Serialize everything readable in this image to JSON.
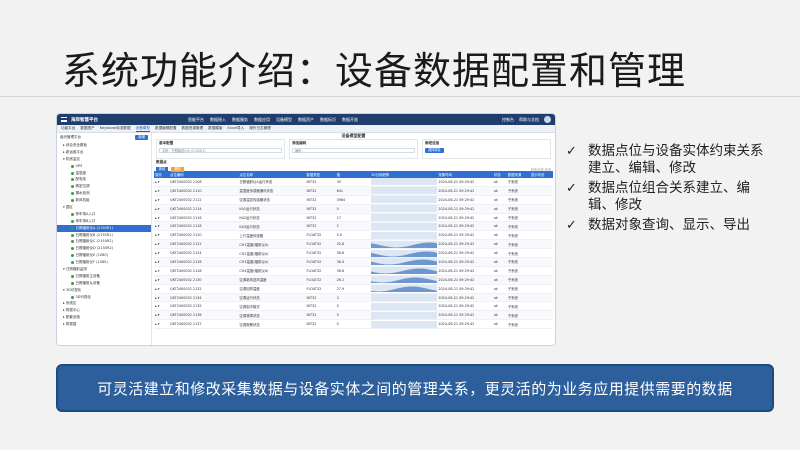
{
  "slide": {
    "title": "系统功能介绍：设备数据配置和管理",
    "bullets": [
      "数据点位与设备实体约束关系建立、编辑、修改",
      "数据点位组合关系建立、编辑、修改",
      "数据对象查询、显示、导出"
    ],
    "banner": "可灵活建立和修改采集数据与设备实体之间的管理关系，更灵活的为业务应用提供需要的数据"
  },
  "app": {
    "brand": "海岸智慧平台",
    "nav": [
      "智能平台",
      "数据接入",
      "数据服务",
      "数据应用",
      "设备模型",
      "数据资产",
      "数据标识",
      "数据开放"
    ],
    "right": [
      "控制台",
      "帮助与文档"
    ],
    "tabs": [
      "功能平台",
      "数据资产",
      "Keystone标准数据",
      "设备模型",
      "数据编辑配置",
      "数据资源管理",
      "数据模版",
      "Excel导入",
      "操作日志管理"
    ],
    "active_tab": "设备模型",
    "sidebar": {
      "header": "组织管理平台",
      "button": "新增",
      "items": [
        {
          "label": "▸ 综合安全看板",
          "sel": false,
          "dot": false
        },
        {
          "label": "▸ 新运维平台",
          "sel": false,
          "dot": false
        },
        {
          "label": "▾ 机房监控",
          "sel": false,
          "dot": false
        },
        {
          "label": "UPS",
          "sel": false,
          "dot": true
        },
        {
          "label": "温湿度",
          "sel": false,
          "dot": true
        },
        {
          "label": "配电柜",
          "sel": false,
          "dot": true
        },
        {
          "label": "精密空调",
          "sel": false,
          "dot": true
        },
        {
          "label": "漏水检测",
          "sel": false,
          "dot": true
        },
        {
          "label": "新风机组",
          "sel": false,
          "dot": true
        },
        {
          "label": "▾ 园区",
          "sel": false,
          "dot": false
        },
        {
          "label": "停车场A入口",
          "sel": false,
          "dot": true
        },
        {
          "label": "停车场B入口",
          "sel": false,
          "dot": true
        },
        {
          "label": "日照辐射仪A (2150R1)",
          "sel": true,
          "dot": true
        },
        {
          "label": "日照辐射仪B (2150R1)",
          "sel": false,
          "dot": true
        },
        {
          "label": "日照辐射仪C (2150R2)",
          "sel": false,
          "dot": true
        },
        {
          "label": "日照辐射仪D (2150R2)",
          "sel": false,
          "dot": true
        },
        {
          "label": "日照辐射仪E (1080)",
          "sel": false,
          "dot": true
        },
        {
          "label": "日照辐射仪F (1080)",
          "sel": false,
          "dot": true
        },
        {
          "label": "▾ 日照辐射监测",
          "sel": false,
          "dot": false
        },
        {
          "label": "日照辐射主设备",
          "sel": false,
          "dot": true
        },
        {
          "label": "日照辐射从设备",
          "sel": false,
          "dot": true
        },
        {
          "label": "▾ 3D可视化",
          "sel": false,
          "dot": false
        },
        {
          "label": "3D可视化",
          "sel": false,
          "dot": true
        },
        {
          "label": "▸ 系统区",
          "sel": false,
          "dot": false
        },
        {
          "label": "▸ 附属中心",
          "sel": false,
          "dot": false
        },
        {
          "label": "▸ 配套设施",
          "sel": false,
          "dot": false
        },
        {
          "label": "▸ 附属楼",
          "sel": false,
          "dot": false
        }
      ]
    },
    "main": {
      "section_title": "设备模型配置",
      "panel1": {
        "title": "基本配置",
        "field": "名称：日照辐射仪A (2150R1)"
      },
      "panel2": {
        "title": "添加编码",
        "field": "编码："
      },
      "panel3": {
        "title": "绑定设备",
        "button": "选择绑定"
      },
      "data_title": "数据点",
      "toolbar": {
        "add": "新增",
        "delete": "删除",
        "search": "检索名称  查询"
      },
      "columns": [
        "操作",
        "点位编码",
        "点位名称",
        "数据类型",
        "值",
        "30分钟趋势",
        "采集时间",
        "状态",
        "数据来源",
        "显示状态"
      ],
      "rows": [
        [
          "▴ ▾",
          "QKT2400032 2108",
          "日照辐射仪A运行状态",
          "INT32",
          "30",
          "",
          "2024-08-21 09:29:42",
          "ok",
          "子系统",
          ""
        ],
        [
          "▴ ▾",
          "QKT2400032 2110",
          "温湿度传感器通讯状态",
          "INT32",
          "641",
          "",
          "2024-08-21 09:29:42",
          "ok",
          "子系统",
          ""
        ],
        [
          "▴ ▾",
          "QKT2400032 2112",
          "空调温控传感器状态",
          "INT32",
          "3984",
          "",
          "2024-08-21 09:29:42",
          "ok",
          "子系统",
          ""
        ],
        [
          "▴ ▾",
          "QKT2400032 2114",
          "KA1运行状态",
          "INT32",
          "0",
          "",
          "2024-08-21 09:29:42",
          "ok",
          "子系统",
          ""
        ],
        [
          "▴ ▾",
          "QKT2400032 2116",
          "KA2运行状态",
          "INT32",
          "17",
          "",
          "2024-08-21 09:29:42",
          "ok",
          "子系统",
          ""
        ],
        [
          "▴ ▾",
          "QKT2400032 2118",
          "KA3运行状态",
          "INT32",
          "2",
          "",
          "2024-08-21 09:29:42",
          "ok",
          "子系统",
          ""
        ],
        [
          "▴ ▾",
          "QKT2400032 2120",
          "上行温度传感器",
          "FLOAT32",
          "0.0",
          "",
          "2024-08-21 09:29:42",
          "ok",
          "子系统",
          ""
        ],
        [
          "▴ ▾",
          "QKT2400032 2122",
          "CH1温度(辐射仪A)",
          "FLOAT32",
          "32.8",
          "",
          "2024-08-21 09:29:42",
          "ok",
          "子系统",
          ""
        ],
        [
          "▴ ▾",
          "QKT2400032 2124",
          "CH2温度(辐射仪A)",
          "FLOAT32",
          "36.8",
          "",
          "2024-08-21 09:29:42",
          "ok",
          "子系统",
          ""
        ],
        [
          "▴ ▾",
          "QKT2400032 2126",
          "CH3温度(辐射仪A)",
          "FLOAT32",
          "36.4",
          "",
          "2024-08-21 09:29:42",
          "ok",
          "子系统",
          ""
        ],
        [
          "▴ ▾",
          "QKT2400032 2128",
          "CH4温度(辐射仪A)",
          "FLOAT32",
          "36.8",
          "",
          "2024-08-21 09:29:42",
          "ok",
          "子系统",
          ""
        ],
        [
          "▴ ▾",
          "QKT2400032 2130",
          "空调新风送风温度",
          "FLOAT32",
          "26.1",
          "",
          "2024-08-21 09:29:42",
          "ok",
          "子系统",
          ""
        ],
        [
          "▴ ▾",
          "QKT2400032 2132",
          "空调回风温度",
          "FLOAT32",
          "27.9",
          "",
          "2024-08-21 09:29:42",
          "ok",
          "子系统",
          ""
        ],
        [
          "▴ ▾",
          "QKT2400032 2134",
          "空调运行状态",
          "INT32",
          "3",
          "",
          "2024-08-21 09:29:42",
          "ok",
          "子系统",
          ""
        ],
        [
          "▴ ▾",
          "QKT2400032 2135",
          "空调制冷模式",
          "INT32",
          "0",
          "",
          "2024-08-21 09:29:42",
          "ok",
          "子系统",
          ""
        ],
        [
          "▴ ▾",
          "QKT2400032 2136",
          "空调故障状态",
          "INT32",
          "0",
          "",
          "2024-08-21 09:29:42",
          "ok",
          "子系统",
          ""
        ],
        [
          "▴ ▾",
          "QKT2400032 2137",
          "空调报警状态",
          "INT32",
          "0",
          "",
          "2024-08-21 09:29:42",
          "ok",
          "子系统",
          ""
        ]
      ]
    }
  }
}
